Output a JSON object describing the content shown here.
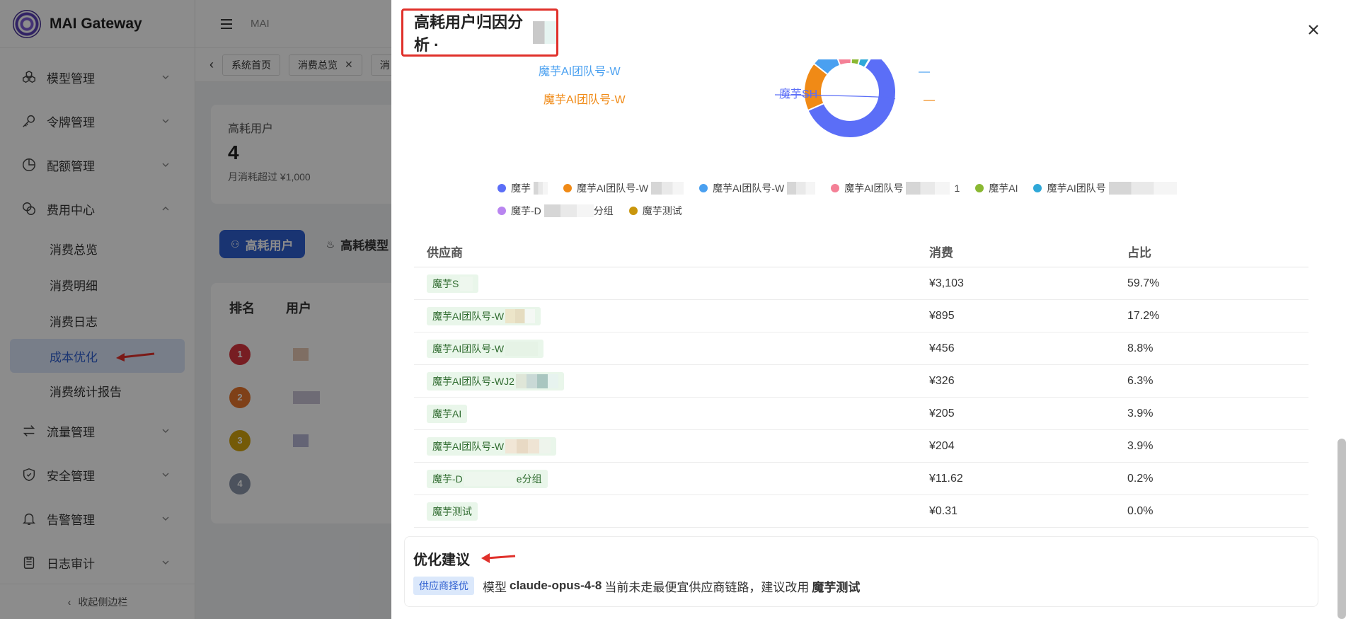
{
  "app": {
    "title": "MAI Gateway",
    "breadcrumb": "MAI",
    "collapse_label": "收起侧边栏"
  },
  "sidebar": {
    "groups": [
      {
        "label": "模型管理",
        "icon": "cubes-icon"
      },
      {
        "label": "令牌管理",
        "icon": "key-icon"
      },
      {
        "label": "配额管理",
        "icon": "pie-chart-icon"
      },
      {
        "label": "费用中心",
        "icon": "coins-icon"
      }
    ],
    "sub_items": [
      "消费总览",
      "消费明细",
      "消费日志",
      "成本优化",
      "消费统计报告"
    ],
    "active_sub": "成本优化",
    "groups_after": [
      {
        "label": "流量管理",
        "icon": "swap-icon"
      },
      {
        "label": "安全管理",
        "icon": "shield-icon"
      },
      {
        "label": "告警管理",
        "icon": "bell-icon"
      },
      {
        "label": "日志审计",
        "icon": "clipboard-icon"
      }
    ]
  },
  "tabs": [
    {
      "label": "系统首页",
      "closable": false
    },
    {
      "label": "消费总览",
      "closable": true
    },
    {
      "label": "消",
      "closable": false
    }
  ],
  "background": {
    "stat": {
      "label": "高耗用户",
      "value": "4",
      "sub": "月消耗超过 ¥1,000"
    },
    "segments": [
      "高耗用户",
      "高耗模型"
    ],
    "rank_headers": [
      "排名",
      "用户"
    ],
    "ranks": [
      "1",
      "2",
      "3",
      "4"
    ]
  },
  "drawer": {
    "title": "高耗用户归因分析 ·",
    "close_label": "×"
  },
  "chart_data": {
    "type": "pie",
    "donut": true,
    "series": [
      {
        "name": "魔芋SH",
        "value": 3103,
        "color": "#5b6ef7"
      },
      {
        "name": "魔芋AI团队号-W",
        "value": 895,
        "color": "#f08a16"
      },
      {
        "name": "魔芋AI团队号-W",
        "value": 456,
        "color": "#4aa0f0"
      },
      {
        "name": "魔芋AI团队号-WJ2",
        "value": 326,
        "color": "#f48096"
      },
      {
        "name": "魔芋AI",
        "value": 205,
        "color": "#8ab832"
      },
      {
        "name": "魔芋AI团队号-W",
        "value": 204,
        "color": "#2fa8d8"
      },
      {
        "name": "魔芋-D",
        "value": 11.62,
        "color": "#b985f0"
      },
      {
        "name": "魔芋测试",
        "value": 0.31,
        "color": "#c9960c"
      }
    ],
    "slice_labels": [
      "魔芋AI团队号-WJ2",
      "魔芋AI团队号-W",
      "魔芋AI团队号-W",
      "魔芋SH"
    ],
    "legend": {
      "row1": [
        "魔芋",
        "魔芋AI团队号-W",
        "魔芋AI团队号-W",
        "魔芋AI团队号",
        "魔芋AI",
        "魔芋AI团队号"
      ],
      "row1_suffix_4": "1",
      "row2": [
        "魔芋-D",
        "魔芋测试"
      ],
      "row2_suffix_1": "分组"
    }
  },
  "table": {
    "headers": [
      "供应商",
      "消费",
      "占比"
    ],
    "rows": [
      {
        "vendor": "魔芋S",
        "cost": "¥3,103",
        "pct": "59.7%"
      },
      {
        "vendor": "魔芋AI团队号-W",
        "cost": "¥895",
        "pct": "17.2%"
      },
      {
        "vendor": "魔芋AI团队号-W",
        "cost": "¥456",
        "pct": "8.8%"
      },
      {
        "vendor": "魔芋AI团队号-WJ2",
        "cost": "¥326",
        "pct": "6.3%"
      },
      {
        "vendor": "魔芋AI",
        "cost": "¥205",
        "pct": "3.9%"
      },
      {
        "vendor": "魔芋AI团队号-W",
        "cost": "¥204",
        "pct": "3.9%"
      },
      {
        "vendor": "魔芋-D",
        "vendor_suffix": "e分组",
        "cost": "¥11.62",
        "pct": "0.2%"
      },
      {
        "vendor": "魔芋测试",
        "cost": "¥0.31",
        "pct": "0.0%"
      }
    ]
  },
  "suggestion": {
    "title": "优化建议",
    "tag": "供应商择优",
    "text_pre": "模型",
    "model": "claude-opus-4-8",
    "text_mid": "当前未走最便宜供应商链路，建议改用",
    "target": "魔芋测试"
  }
}
